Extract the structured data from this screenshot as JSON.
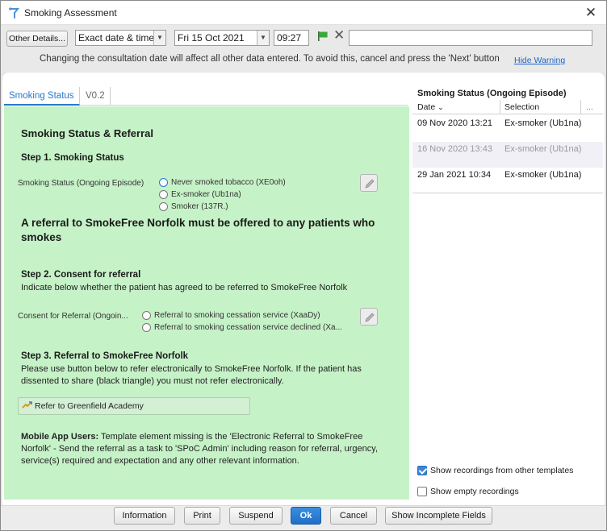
{
  "window": {
    "title": "Smoking Assessment",
    "close": "✕"
  },
  "toolbar": {
    "other_details": "Other Details...",
    "date_mode": "Exact date & time",
    "date": "Fri 15 Oct 2021",
    "time": "09:27",
    "free_text": "",
    "warning": "Changing the consultation date will affect all other data entered. To avoid this, cancel and press the 'Next' button",
    "hide_warning": "Hide Warning"
  },
  "tabs": [
    {
      "label": "Smoking Status",
      "active": true
    },
    {
      "label": "V0.2",
      "active": false
    }
  ],
  "form": {
    "heading": "Smoking Status & Referral",
    "step1": {
      "title": "Step 1. Smoking Status",
      "field_label": "Smoking Status (Ongoing Episode)",
      "options": [
        "Never smoked tobacco (XE0oh)",
        "Ex-smoker (Ub1na)",
        "Smoker (137R.)"
      ]
    },
    "referral_notice": "A referral to SmokeFree Norfolk must be offered to any patients who smokes",
    "step2": {
      "title": "Step 2. Consent for referral",
      "description": "Indicate below whether the patient has agreed to be referred to SmokeFree Norfolk",
      "field_label": "Consent for Referral (Ongoin...",
      "options": [
        "Referral to smoking cessation service (XaaDy)",
        "Referral to smoking cessation service declined (Xa..."
      ]
    },
    "step3": {
      "title": "Step 3. Referral to SmokeFree Norfolk",
      "description": "Please use button below to refer electronically to SmokeFree Norfolk. If the patient has dissented to share (black triangle) you must not refer electronically.",
      "refer_button": "Refer to Greenfield Academy"
    },
    "mobile_note": {
      "bold": "Mobile App Users:",
      "text": " Template element missing is the 'Electronic Referral to SmokeFree Norfolk' - Send the referral as a task to 'SPoC Admin' including reason for referral, urgency, service(s) required and expectation and any other relevant information."
    }
  },
  "history": {
    "title": "Smoking Status (Ongoing Episode)",
    "columns": {
      "date": "Date",
      "selection": "Selection",
      "more": "..."
    },
    "rows": [
      {
        "date": "09 Nov 2020 13:21",
        "selection": "Ex-smoker (Ub1na)",
        "greyed": false
      },
      {
        "date": "16 Nov 2020 13:43",
        "selection": "Ex-smoker (Ub1na)",
        "greyed": true
      },
      {
        "date": "29 Jan 2021 10:34",
        "selection": "Ex-smoker (Ub1na)",
        "greyed": false
      }
    ],
    "show_other_templates": {
      "label": "Show recordings from other templates",
      "checked": true
    },
    "show_empty": {
      "label": "Show empty recordings",
      "checked": false
    }
  },
  "footer": {
    "information": "Information",
    "print": "Print",
    "suspend": "Suspend",
    "ok": "Ok",
    "cancel": "Cancel",
    "show_incomplete": "Show Incomplete Fields"
  },
  "colors": {
    "form_background": "#c6f2c7",
    "accent_blue": "#2a78c8",
    "ok_button": "#2a7bd2",
    "flag_green": "#3aa83a"
  },
  "icons": [
    "app-logo-icon",
    "close-icon",
    "flag-icon",
    "clear-x-icon",
    "chevron-down-icon",
    "pencil-edit-icon",
    "refer-icon"
  ]
}
